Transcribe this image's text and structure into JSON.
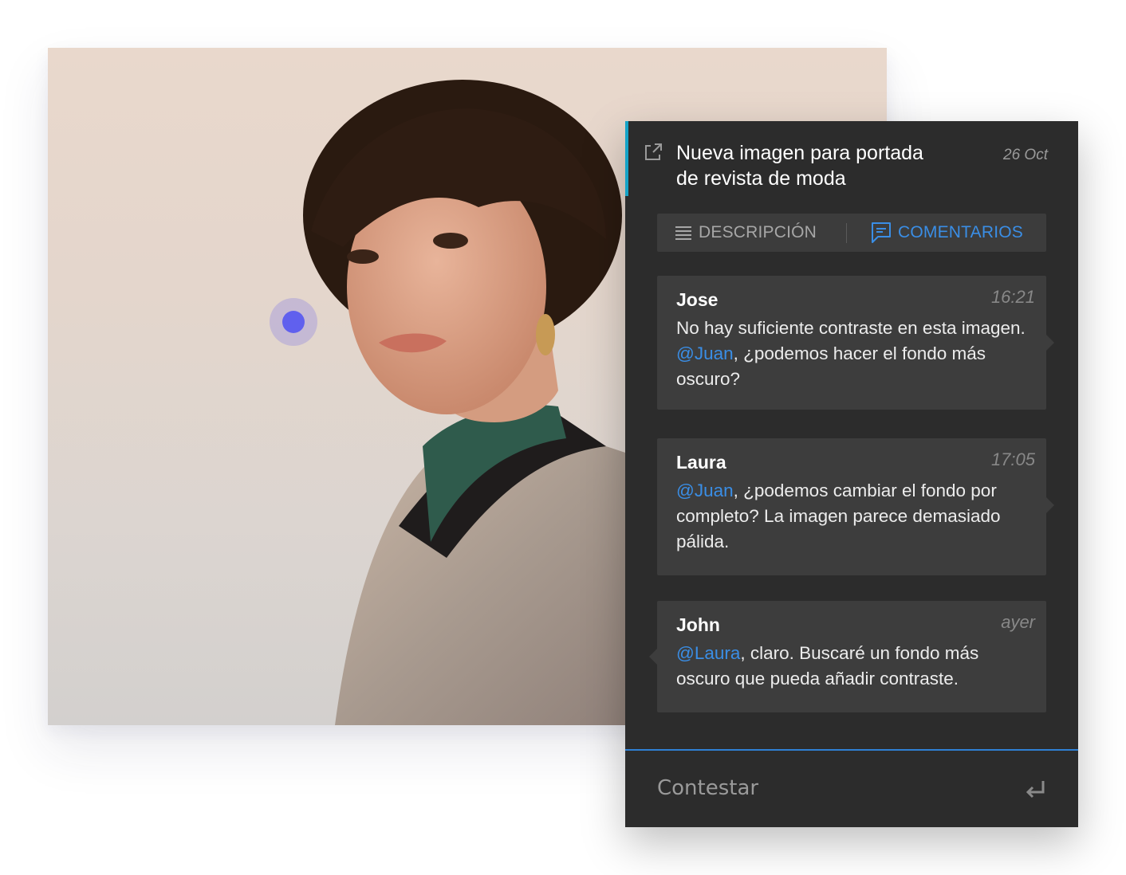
{
  "post": {
    "title_line1": "Nueva imagen para portada",
    "title_line2": "de revista de moda",
    "date": "26 Oct"
  },
  "tabs": {
    "description": "DESCRIPCIÓN",
    "comments": "COMENTARIOS",
    "active": "comments"
  },
  "comments": [
    {
      "author": "Jose",
      "time": "16:21",
      "text_before": "No hay suficiente contraste en esta imagen. ",
      "mention": "@Juan",
      "text_after": ", ¿podemos hacer el fondo más oscuro?"
    },
    {
      "author": "Laura",
      "time": "17:05",
      "text_before": "",
      "mention": "@Juan",
      "text_after": ", ¿podemos cambiar el fondo por completo? La imagen parece demasiado pálida."
    },
    {
      "author": "John",
      "time": "ayer",
      "text_before": "",
      "mention": "@Laura",
      "text_after": ", claro. Buscaré un fondo más oscuro que pueda añadir contraste."
    }
  ],
  "reply": {
    "placeholder": "Contestar"
  },
  "icons": {
    "open_external": "external-link-icon",
    "description_tab": "lines-icon",
    "comments_tab": "speech-bubble-icon",
    "submit": "enter-icon",
    "annotation_pin": "pin-dot"
  },
  "colors": {
    "panel_bg": "#2c2c2c",
    "accent_teal": "#14a3c7",
    "link_blue": "#3a8ee6",
    "pin": "#6060ee"
  }
}
